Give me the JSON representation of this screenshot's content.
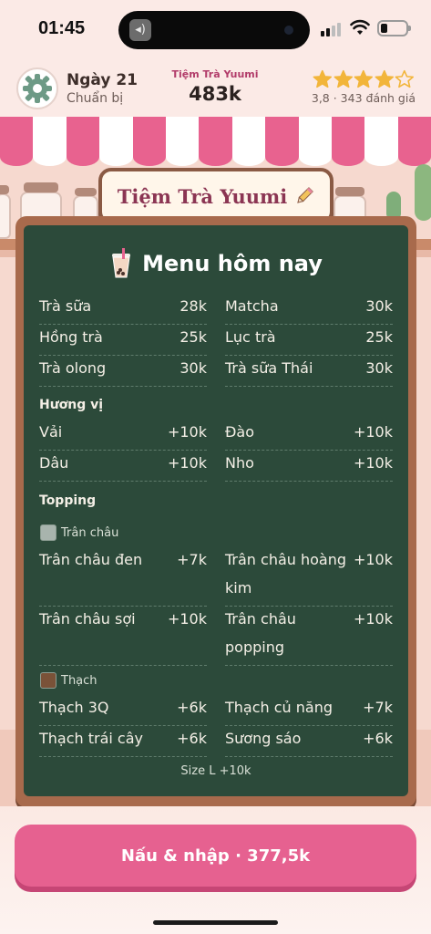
{
  "status_bar": {
    "time": "01:45"
  },
  "header": {
    "day": "Ngày 21",
    "phase": "Chuẩn bị",
    "shop_name": "Tiệm Trà Yuumi",
    "money": "483k",
    "rating": 3.8,
    "stars_filled": 4,
    "stars_total": 5,
    "rating_text": "3,8 · 343 đánh giá"
  },
  "sign": {
    "title": "Tiệm Trà Yuumi",
    "edit_icon": "pencil-icon"
  },
  "menu": {
    "title": "Menu hôm nay",
    "title_icon": "bubble-tea-icon",
    "teas": [
      {
        "name": "Trà sữa",
        "price": "28k"
      },
      {
        "name": "Matcha",
        "price": "30k"
      },
      {
        "name": "Hồng trà",
        "price": "25k"
      },
      {
        "name": "Lục trà",
        "price": "25k"
      },
      {
        "name": "Trà olong",
        "price": "30k"
      },
      {
        "name": "Trà sữa Thái",
        "price": "30k"
      }
    ],
    "flavor_label": "Hương vị",
    "flavors": [
      {
        "name": "Vải",
        "price": "+10k"
      },
      {
        "name": "Đào",
        "price": "+10k"
      },
      {
        "name": "Dâu",
        "price": "+10k"
      },
      {
        "name": "Nho",
        "price": "+10k"
      }
    ],
    "topping_label": "Topping",
    "pearl_label": "Trân châu",
    "pearls": [
      {
        "name": "Trân châu đen",
        "price": "+7k"
      },
      {
        "name": "Trân châu hoàng kim",
        "price": "+10k"
      },
      {
        "name": "Trân châu sợi",
        "price": "+10k"
      },
      {
        "name": "Trân châu popping",
        "price": "+10k"
      }
    ],
    "jelly_label": "Thạch",
    "jellies": [
      {
        "name": "Thạch 3Q",
        "price": "+6k"
      },
      {
        "name": "Thạch củ năng",
        "price": "+7k"
      },
      {
        "name": "Thạch trái cây",
        "price": "+6k"
      },
      {
        "name": "Sương sáo",
        "price": "+6k"
      }
    ],
    "size_note": "Size L +10k"
  },
  "cta": {
    "label": "Nấu & nhập · 377,5k"
  },
  "colors": {
    "accent_pink": "#e66190",
    "board_green": "#2c4a3a",
    "star_gold": "#f2b53a"
  }
}
